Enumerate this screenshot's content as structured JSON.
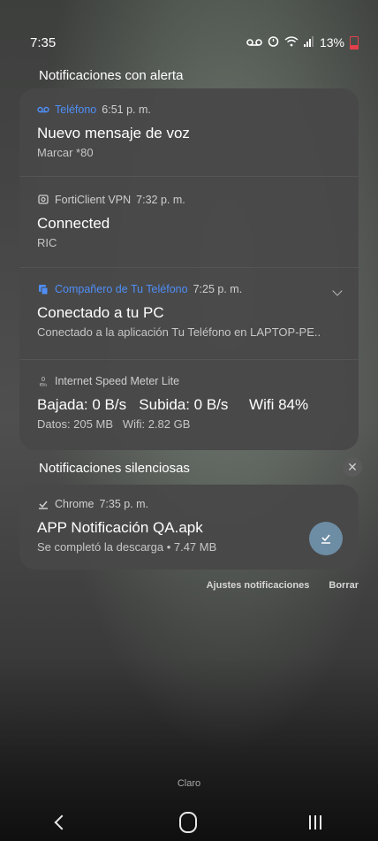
{
  "status_bar": {
    "time": "7:35",
    "battery_text": "13%",
    "icons": [
      "voicemail-icon",
      "alarm-icon",
      "wifi-icon",
      "signal-icon",
      "battery-icon"
    ]
  },
  "alert_section": {
    "title": "Notificaciones con alerta",
    "notifications": [
      {
        "app": "Teléfono",
        "time": "6:51 p. m.",
        "title": "Nuevo mensaje de voz",
        "body": "Marcar *80",
        "icon": "voicemail-icon",
        "app_color": "#4f8ef7"
      },
      {
        "app": "FortiClient VPN",
        "time": "7:32 p. m.",
        "title": "Connected",
        "body": "RIC",
        "icon": "vpn-icon"
      },
      {
        "app": "Compañero de Tu Teléfono",
        "time": "7:25 p. m.",
        "title": "Conectado a tu PC",
        "body": "Conectado a la aplicación Tu Teléfono en LAPTOP-PE..",
        "icon": "phone-link-icon",
        "app_color": "#4f8ef7"
      },
      {
        "app": "Internet Speed Meter Lite",
        "time": "",
        "title": "Bajada: 0 B/s   Subida: 0 B/s     Wifi 84%",
        "body": "Datos: 205 MB   Wifi: 2.82 GB",
        "icon": "speed-meter-icon"
      }
    ]
  },
  "silent_section": {
    "title": "Notificaciones silenciosas",
    "notifications": [
      {
        "app": "Chrome",
        "time": "7:35 p. m.",
        "title": "APP Notificación QA.apk",
        "body": "Se completó la descarga • 7.47 MB",
        "icon": "download-icon"
      }
    ]
  },
  "actions": {
    "settings": "Ajustes notificaciones",
    "clear": "Borrar"
  },
  "carrier": "Claro",
  "colors": {
    "accent_blue": "#4f8ef7",
    "card_bg": "#484848",
    "download_button": "#6d8da5"
  }
}
